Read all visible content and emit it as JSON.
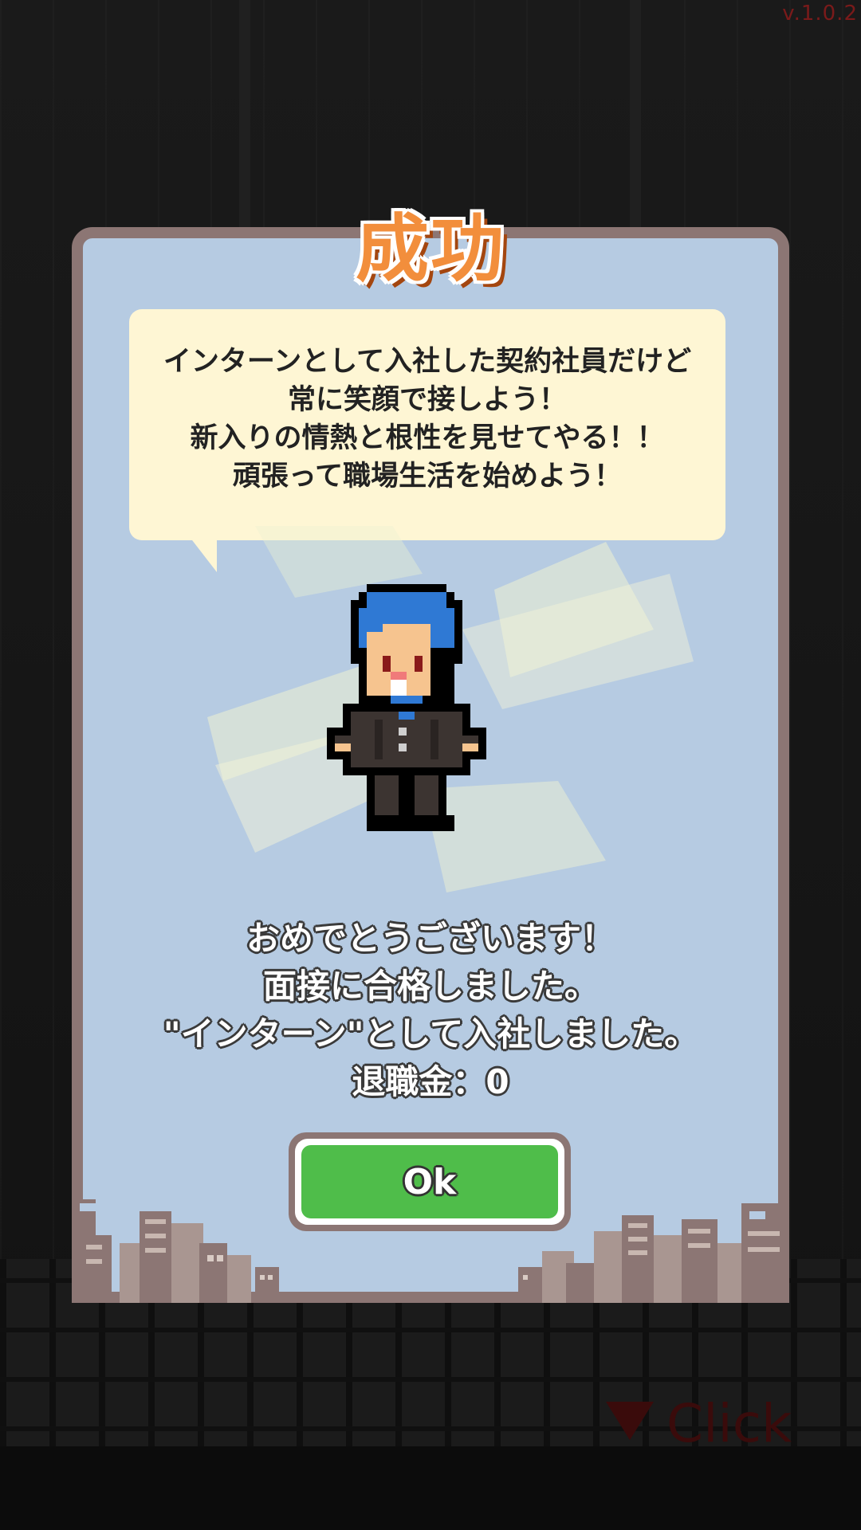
{
  "version": "v.1.0.2",
  "dialog": {
    "title": "成功",
    "speech_lines": [
      "インターンとして入社した契約社員だけど",
      "常に笑顔で接しよう！",
      "新入りの情熱と根性を見せてやる！！",
      "頑張って職場生活を始めよう！"
    ],
    "result_lines": [
      "おめでとうございます！",
      "面接に合格しました。",
      "\"インターン\"として入社しました。",
      "退職金：0"
    ],
    "ok_label": "Ok"
  },
  "hint": {
    "click_label": "Click"
  },
  "colors": {
    "dialog_bg": "#b6cbe2",
    "frame": "#8c7674",
    "bubble": "#fef6d4",
    "title": "#f28e3c",
    "ok_green": "#4fbd4a"
  },
  "icons": {
    "character": "office-worker-sprite",
    "hint": "down-triangle-icon"
  }
}
